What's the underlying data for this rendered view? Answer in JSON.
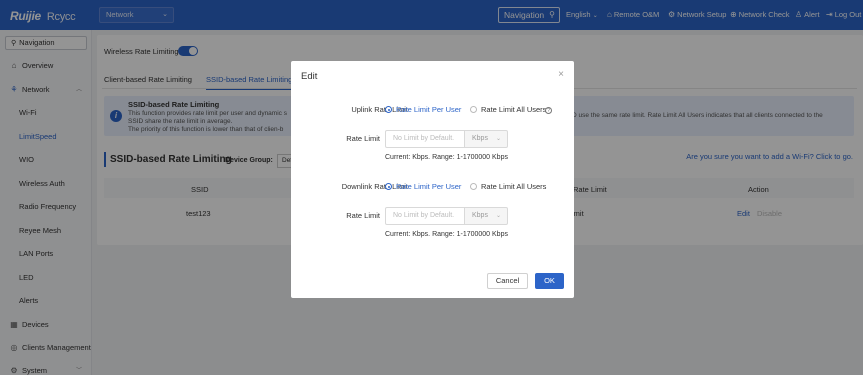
{
  "header": {
    "brand": "Ruijie",
    "brand_sub": "Rcycc",
    "network_select": "Network",
    "navigation_label": "Navigation",
    "language": "English",
    "remote_om": "Remote O&M",
    "network_setup": "Network Setup",
    "network_check": "Network Check",
    "alert": "Alert",
    "log_out": "Log Out"
  },
  "sidebar": {
    "search_label": "Navigation",
    "items": [
      {
        "label": "Overview",
        "icon": "home-icon"
      },
      {
        "label": "Network",
        "icon": "network-icon"
      },
      {
        "label": "Wi-Fi"
      },
      {
        "label": "LimitSpeed"
      },
      {
        "label": "WIO"
      },
      {
        "label": "Wireless Auth"
      },
      {
        "label": "Radio Frequency"
      },
      {
        "label": "Reyee Mesh"
      },
      {
        "label": "LAN Ports"
      },
      {
        "label": "LED"
      },
      {
        "label": "Alerts"
      },
      {
        "label": "Devices",
        "icon": "devices-icon"
      },
      {
        "label": "Clients Management",
        "icon": "clients-icon"
      },
      {
        "label": "System",
        "icon": "system-icon"
      }
    ]
  },
  "main": {
    "toggle_label": "Wireless Rate Limiting",
    "toggle_on": true,
    "tabs": [
      "Client-based Rate Limiting",
      "SSID-based Rate Limiting"
    ],
    "info": {
      "title": "SSID-based Rate Limiting",
      "line1": "This function provides rate limit per user and dynamic s",
      "line2": "SSID share the rate limit in average.",
      "line3": "The priority of this function is lower than that of clien-b",
      "right": "D use the same rate limit. Rate Limit All Users indicates that all clients connected to the"
    },
    "section_title": "SSID-based Rate Limiting",
    "device_group_label": "Device Group:",
    "device_group_value": "Def",
    "add_wifi_link": "Are you sure you want to add a Wi-Fi? Click to go.",
    "table": {
      "headers": [
        "SSID",
        "Rate Limit",
        "Action"
      ],
      "rows": [
        {
          "ssid": "test123",
          "rate_limit": "imit",
          "edit": "Edit",
          "disable": "Disable"
        }
      ]
    }
  },
  "modal": {
    "title": "Edit",
    "uplink": {
      "label": "Uplink Rate Limit",
      "option_per_user": "Rate Limit Per User",
      "option_all_users": "Rate Limit All Users",
      "rate_label": "Rate Limit",
      "placeholder": "No Limit by Default.",
      "unit": "Kbps",
      "hint": "Current:   Kbps. Range: 1-1700000 Kbps"
    },
    "downlink": {
      "label": "Downlink Rate Limit",
      "option_per_user": "Rate Limit Per User",
      "option_all_users": "Rate Limit All Users",
      "rate_label": "Rate Limit",
      "placeholder": "No Limit by Default.",
      "unit": "Kbps",
      "hint": "Current:   Kbps. Range: 1-1700000 Kbps"
    },
    "cancel": "Cancel",
    "ok": "OK"
  },
  "colors": {
    "accent": "#2c64c8",
    "header_bg": "#2c64c8",
    "overlay": "rgba(0,0,0,0.42)"
  }
}
